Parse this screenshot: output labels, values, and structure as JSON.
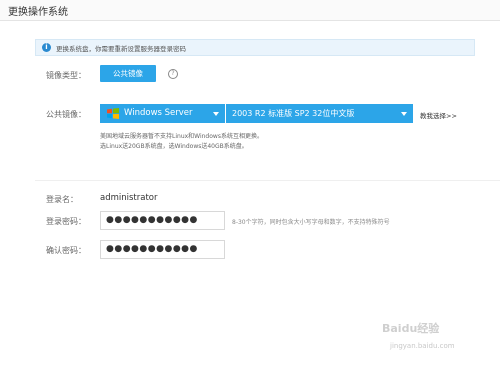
{
  "header": {
    "title": "更换操作系统"
  },
  "notice": {
    "icon": "info-icon",
    "text": "更换系统盘，你需要重新设置服务器登录密码"
  },
  "image_type": {
    "label": "镜像类型：",
    "button": "公共镜像"
  },
  "public_image": {
    "label": "公共镜像：",
    "os_value": "Windows Server",
    "version_value": "2003 R2 标准版 SP2 32位中文版",
    "help_link": "教我选择>>",
    "note1": "美国地域云服务器暂不支持Linux和Windows系统互相更换。",
    "note2": "选Linux送20GB系统盘，选Windows送40GB系统盘。"
  },
  "login": {
    "username_label": "登录名：",
    "username_value": "administrator",
    "password_label": "登录密码：",
    "password_value": "●●●●●●●●●●●",
    "password_hint": "8-30个字符，同时包含大小写字母和数字，不支持特殊符号",
    "confirm_label": "确认密码：",
    "confirm_value": "●●●●●●●●●●●"
  },
  "watermark": {
    "brand": "Baidu经验",
    "url": "jingyan.baidu.com"
  },
  "colors": {
    "accent": "#2ca5e8",
    "notice_bg": "#eaf4fc",
    "info_icon": "#2a8ad0"
  }
}
